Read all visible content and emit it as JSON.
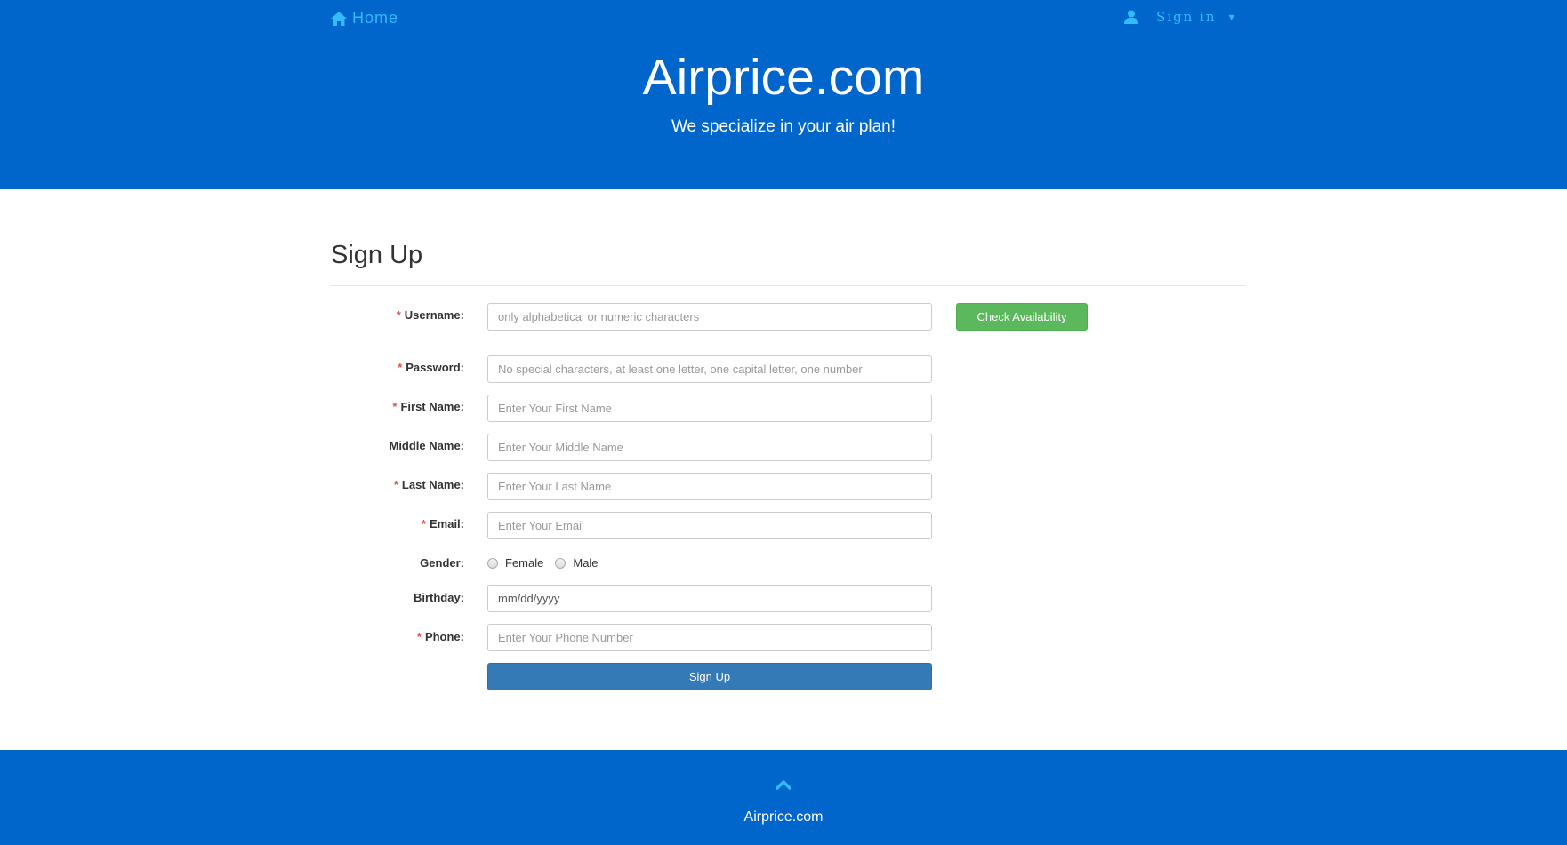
{
  "nav": {
    "home_label": "Home",
    "signin_label": "Sign in",
    "home_icon": "home-icon",
    "user_icon": "user-icon",
    "caret_icon": "caret-down-icon"
  },
  "header": {
    "title": "Airprice.com",
    "tagline": "We specialize in your air plan!"
  },
  "form": {
    "heading": "Sign Up",
    "fields": {
      "username": {
        "label": "Username:",
        "required": "*",
        "placeholder": "only alphabetical or numeric characters"
      },
      "password": {
        "label": "Password:",
        "required": "*",
        "placeholder": "No special characters, at least one letter, one capital letter, one number"
      },
      "first_name": {
        "label": "First Name:",
        "required": "*",
        "placeholder": "Enter Your First Name"
      },
      "middle_name": {
        "label": "Middle Name:",
        "placeholder": "Enter Your Middle Name"
      },
      "last_name": {
        "label": "Last Name:",
        "required": "*",
        "placeholder": "Enter Your Last Name"
      },
      "email": {
        "label": "Email:",
        "required": "*",
        "placeholder": "Enter Your Email"
      },
      "gender": {
        "label": "Gender:",
        "options": [
          "Female",
          "Male"
        ]
      },
      "birthday": {
        "label": "Birthday:",
        "value": "mm/dd/yyyy"
      },
      "phone": {
        "label": "Phone:",
        "required": "*",
        "placeholder": "Enter Your Phone Number"
      }
    },
    "check_availability_label": "Check Availability",
    "submit_label": "Sign Up"
  },
  "footer": {
    "text": "Airprice.com",
    "up_icon": "chevron-up-icon"
  },
  "colors": {
    "brand_blue": "#0066cc",
    "link_cyan": "#33bbff",
    "success_green": "#5cb85c",
    "primary_button": "#337ab7",
    "required_red": "#d9534f"
  }
}
